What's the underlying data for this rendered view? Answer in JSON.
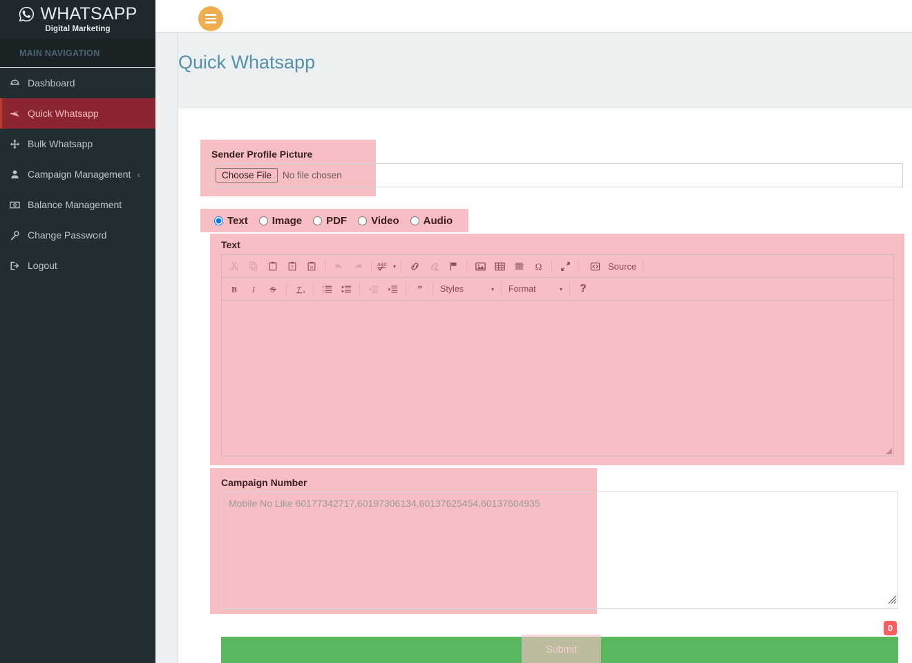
{
  "brand": {
    "name": "WHATSAPP",
    "subtitle": "Digital Marketing",
    "icon": "whatsapp-icon"
  },
  "sidebar": {
    "section_header": "MAIN NAVIGATION",
    "items": [
      {
        "label": "Dashboard",
        "icon": "dashboard-icon",
        "active": false,
        "caret": ""
      },
      {
        "label": "Quick Whatsapp",
        "icon": "paper-plane-icon",
        "active": true,
        "caret": ""
      },
      {
        "label": "Bulk Whatsapp",
        "icon": "arrows-move-icon",
        "active": false,
        "caret": ""
      },
      {
        "label": "Campaign Management",
        "icon": "user-icon",
        "active": false,
        "caret": "‹"
      },
      {
        "label": "Balance Management",
        "icon": "money-icon",
        "active": false,
        "caret": ""
      },
      {
        "label": "Change Password",
        "icon": "key-icon",
        "active": false,
        "caret": ""
      },
      {
        "label": "Logout",
        "icon": "sign-out-icon",
        "active": false,
        "caret": ""
      }
    ]
  },
  "topbar": {
    "menu_toggle_icon": "hamburger-icon"
  },
  "page": {
    "title": "Quick Whatsapp"
  },
  "form": {
    "sender_picture": {
      "label": "Sender Profile Picture",
      "button_label": "Choose File",
      "status_text": "No file chosen"
    },
    "media_type": {
      "options": [
        {
          "label": "Text",
          "selected": true
        },
        {
          "label": "Image",
          "selected": false
        },
        {
          "label": "PDF",
          "selected": false
        },
        {
          "label": "Video",
          "selected": false
        },
        {
          "label": "Audio",
          "selected": false
        }
      ]
    },
    "text_editor": {
      "label": "Text",
      "value": "",
      "toolbar_row1": [
        {
          "name": "cut-icon",
          "glyph": "✂",
          "dim": true
        },
        {
          "name": "copy-icon",
          "glyph": "❐",
          "dim": true
        },
        {
          "name": "paste-icon",
          "glyph": "📋",
          "dim": false
        },
        {
          "name": "paste-as-text-icon",
          "glyph": "📋",
          "dim": false
        },
        {
          "name": "paste-from-word-icon",
          "glyph": "📋",
          "dim": false
        },
        {
          "name": "separator",
          "glyph": "",
          "dim": false
        },
        {
          "name": "undo-icon",
          "glyph": "↶",
          "dim": true
        },
        {
          "name": "redo-icon",
          "glyph": "↷",
          "dim": true
        },
        {
          "name": "separator",
          "glyph": "",
          "dim": false
        },
        {
          "name": "spell-check-icon",
          "glyph": "ABC",
          "dim": false
        },
        {
          "name": "separator",
          "glyph": "",
          "dim": false
        },
        {
          "name": "link-icon",
          "glyph": "🔗",
          "dim": false
        },
        {
          "name": "unlink-icon",
          "glyph": "🔗",
          "dim": true
        },
        {
          "name": "anchor-flag-icon",
          "glyph": "⚑",
          "dim": false
        },
        {
          "name": "separator",
          "glyph": "",
          "dim": false
        },
        {
          "name": "image-icon",
          "glyph": "🖼",
          "dim": false
        },
        {
          "name": "table-icon",
          "glyph": "▦",
          "dim": false
        },
        {
          "name": "horizontal-rule-icon",
          "glyph": "☰",
          "dim": false
        },
        {
          "name": "special-char-icon",
          "glyph": "Ω",
          "dim": false
        },
        {
          "name": "separator",
          "glyph": "",
          "dim": false
        },
        {
          "name": "maximize-icon",
          "glyph": "⤡",
          "dim": false
        },
        {
          "name": "separator",
          "glyph": "",
          "dim": false
        },
        {
          "name": "source-icon",
          "glyph": "◎",
          "dim": false
        }
      ],
      "source_label": "Source",
      "toolbar_row2": [
        {
          "name": "bold-icon",
          "glyph": "B",
          "dim": false
        },
        {
          "name": "italic-icon",
          "glyph": "I",
          "dim": false
        },
        {
          "name": "strikethrough-icon",
          "glyph": "S",
          "dim": false
        },
        {
          "name": "separator",
          "glyph": "",
          "dim": false
        },
        {
          "name": "remove-format-icon",
          "glyph": "T",
          "dim": false
        },
        {
          "name": "separator",
          "glyph": "",
          "dim": false
        },
        {
          "name": "numbered-list-icon",
          "glyph": "≣",
          "dim": false
        },
        {
          "name": "bulleted-list-icon",
          "glyph": "≣",
          "dim": false
        },
        {
          "name": "separator",
          "glyph": "",
          "dim": false
        },
        {
          "name": "outdent-icon",
          "glyph": "⇤",
          "dim": true
        },
        {
          "name": "indent-icon",
          "glyph": "⇥",
          "dim": false
        },
        {
          "name": "separator",
          "glyph": "",
          "dim": false
        },
        {
          "name": "blockquote-icon",
          "glyph": "”",
          "dim": false
        },
        {
          "name": "separator",
          "glyph": "",
          "dim": false
        }
      ],
      "styles_label": "Styles",
      "format_label": "Format",
      "help_label": "?"
    },
    "campaign_number": {
      "label": "Campaign Number",
      "placeholder": "Mobile No Like 60177342717,60197306134,60137625454,60137604935",
      "value": ""
    },
    "submit": {
      "label": "Submit"
    },
    "counter_badge": "0"
  },
  "colors": {
    "sidebar_bg": "#222d32",
    "active_item_bg": "#8b2531",
    "accent_orange": "#f0ad4e",
    "title_blue": "#5591a8",
    "highlight_pink": "#f7bfc3",
    "submit_green": "#58b75f",
    "badge_red": "#fb5d61"
  }
}
